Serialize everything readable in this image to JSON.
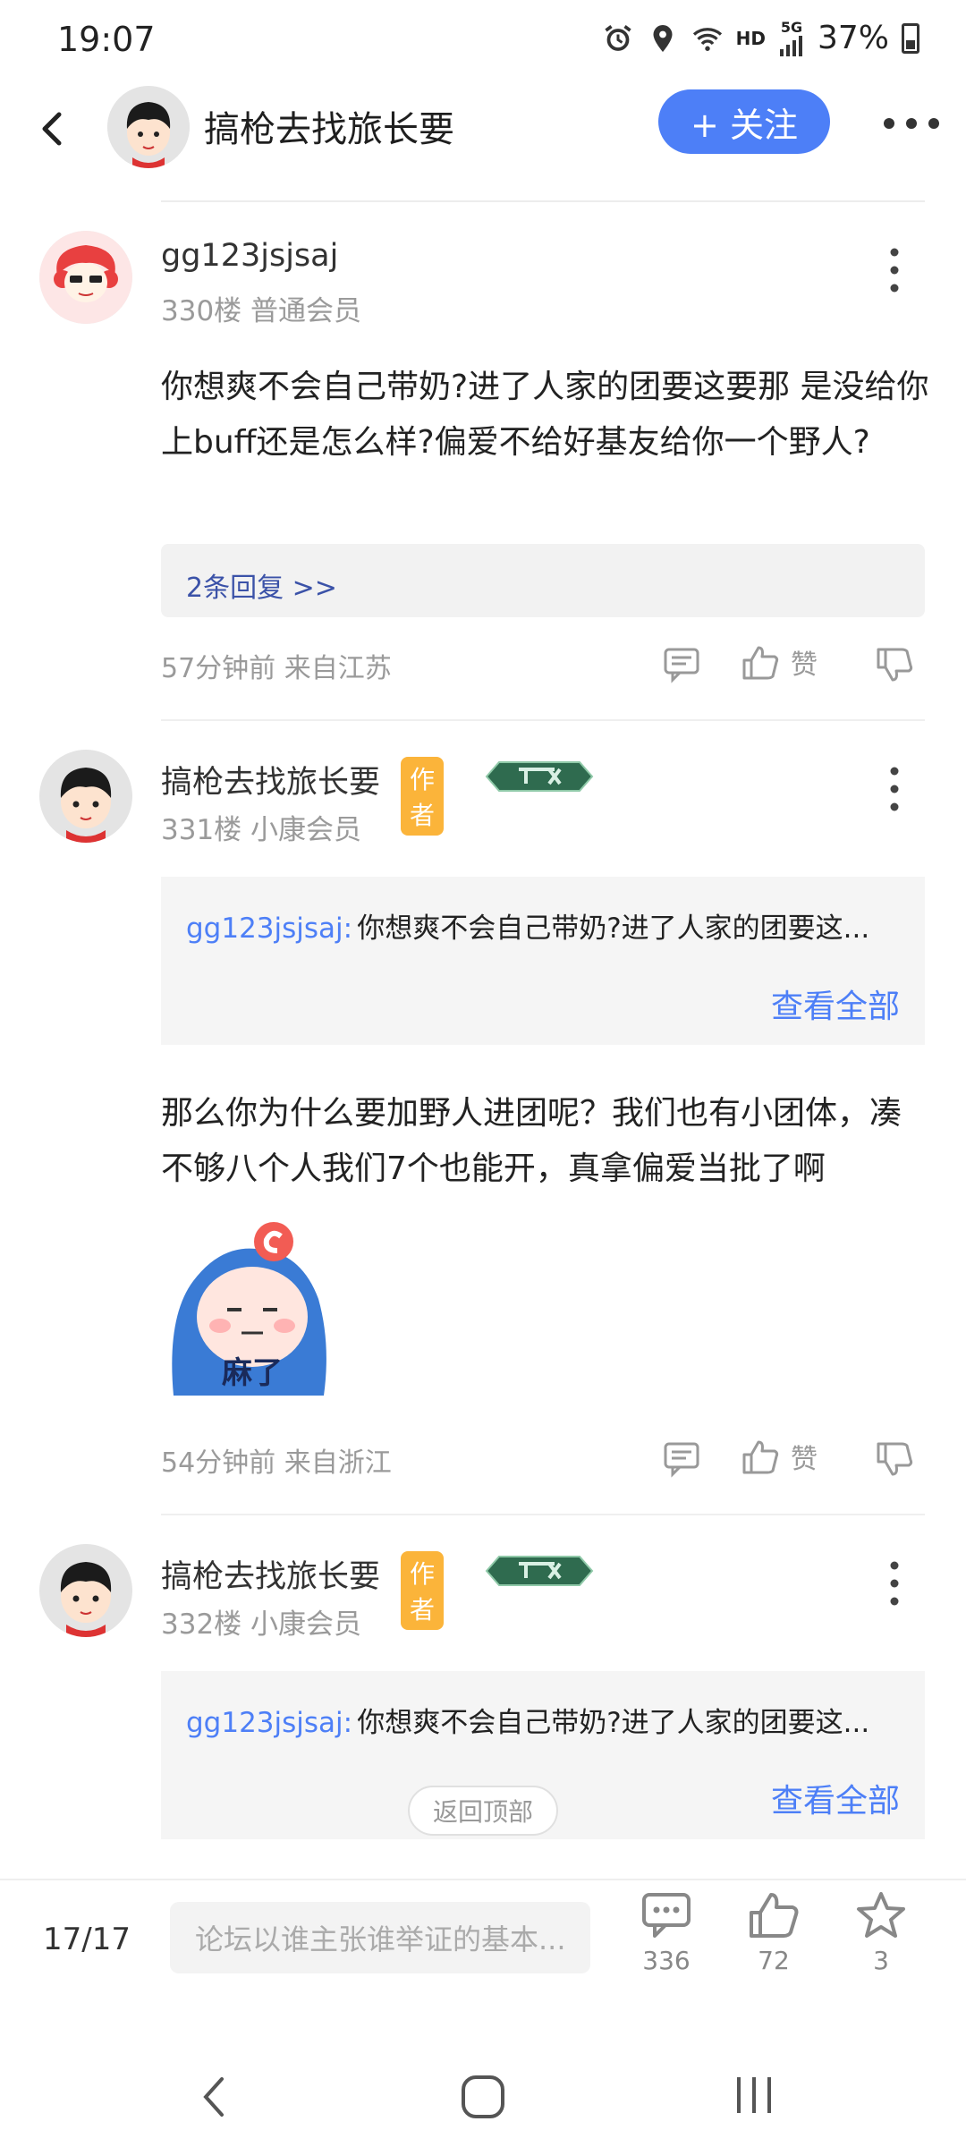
{
  "status_bar": {
    "time": "19:07",
    "network": "HD",
    "network_gen": "5G",
    "battery": "37%",
    "icons": [
      "alarm-icon",
      "location-icon",
      "wifi-icon",
      "signal-icon",
      "battery-icon"
    ]
  },
  "header": {
    "title": "搞枪去找旅长要",
    "follow_label": "+ 关注"
  },
  "posts": [
    {
      "username": "gg123jsjsaj",
      "floor": "330楼 普通会员",
      "content": "你想爽不会自己带奶?进了人家的团要这要那 是没给你上buff还是怎么样?偏爱不给好基友给你一个野人?",
      "replies_link": "2条回复 >>",
      "time_location": "57分钟前 来自江苏",
      "like_label": "赞"
    },
    {
      "username": "搞枪去找旅长要",
      "author_badge": "作者",
      "floor": "331楼 小康会员",
      "quote_user": "gg123jsjsaj:",
      "quote_text": "你想爽不会自己带奶?进了人家的团要这...",
      "see_all": "查看全部",
      "content": "那么你为什么要加野人进团呢？我们也有小团体，凑不够八个人我们7个也能开，真拿偏爱当批了啊",
      "sticker_text": "麻了",
      "time_location": "54分钟前 来自浙江",
      "like_label": "赞"
    },
    {
      "username": "搞枪去找旅长要",
      "author_badge": "作者",
      "floor": "332楼 小康会员",
      "quote_user": "gg123jsjsaj:",
      "quote_text": "你想爽不会自己带奶?进了人家的团要这...",
      "see_all": "查看全部"
    }
  ],
  "back_to_top": "返回顶部",
  "bottom_bar": {
    "page_indicator": "17/17",
    "input_placeholder": "论坛以谁主张谁举证的基本...",
    "comments_count": "336",
    "likes_count": "72",
    "favorites_count": "3"
  },
  "colors": {
    "accent": "#4d7ff7",
    "author_badge": "#fbb43a",
    "reply_link": "#3b52a8"
  }
}
